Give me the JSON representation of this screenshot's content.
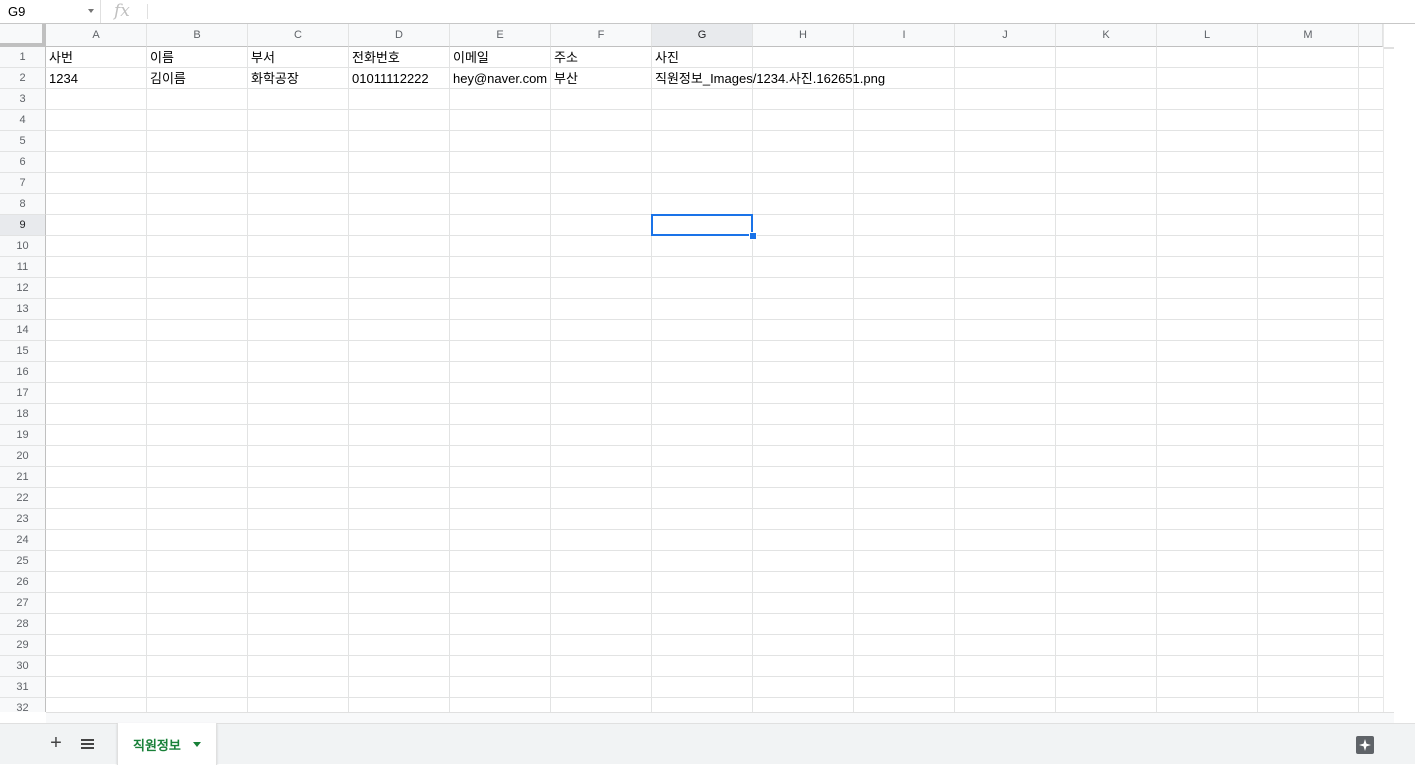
{
  "formula_bar": {
    "name_box": "G9",
    "fx_label": "fx",
    "formula": ""
  },
  "columns": [
    "A",
    "B",
    "C",
    "D",
    "E",
    "F",
    "G",
    "H",
    "I",
    "J",
    "K",
    "L",
    "M"
  ],
  "rows": [
    "1",
    "2",
    "3",
    "4",
    "5",
    "6",
    "7",
    "8",
    "9",
    "10",
    "11",
    "12",
    "13",
    "14",
    "15",
    "16",
    "17",
    "18",
    "19",
    "20",
    "21",
    "22",
    "23",
    "24",
    "25",
    "26",
    "27",
    "28",
    "29",
    "30",
    "31",
    "32"
  ],
  "cells": {
    "A1": "사번",
    "B1": "이름",
    "C1": "부서",
    "D1": "전화번호",
    "E1": "이메일",
    "F1": "주소",
    "G1": "사진",
    "A2": "1234",
    "B2": "김이름",
    "C2": "화학공장",
    "D2": "01011112222",
    "E2": "hey@naver.com",
    "F2": "부산",
    "G2": "직원정보_Images/1234.사진.162651.png"
  },
  "selection": {
    "cell": "G9",
    "active_column": "G",
    "active_row": "9",
    "color": "#1a73e8"
  },
  "sheets": {
    "add_icon": "plus-icon",
    "list_icon": "menu-icon",
    "tabs": [
      {
        "label": "직원정보",
        "active": true
      }
    ],
    "accent_color": "#188038"
  },
  "explore": {
    "icon": "explore-sparkle-icon"
  }
}
